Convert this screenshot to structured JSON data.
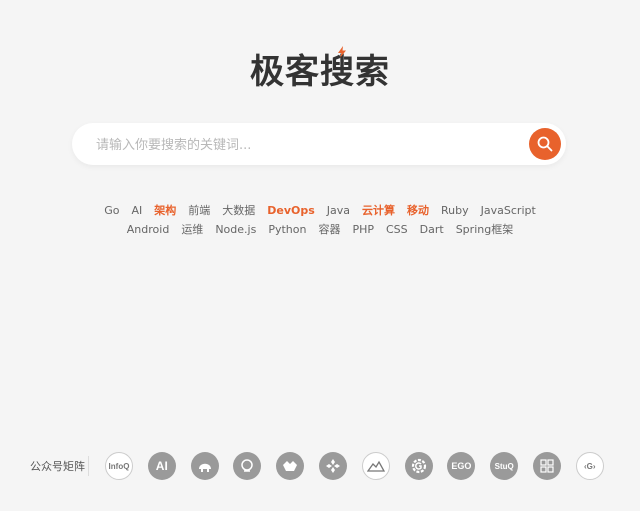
{
  "brand": {
    "logo_text": "极客搜索"
  },
  "search": {
    "placeholder": "请输入你要搜索的关键词..."
  },
  "tags": [
    {
      "label": "Go",
      "hot": false
    },
    {
      "label": "AI",
      "hot": false
    },
    {
      "label": "架构",
      "hot": true
    },
    {
      "label": "前端",
      "hot": false
    },
    {
      "label": "大数据",
      "hot": false
    },
    {
      "label": "DevOps",
      "hot": true
    },
    {
      "label": "Java",
      "hot": false
    },
    {
      "label": "云计算",
      "hot": true
    },
    {
      "label": "移动",
      "hot": true
    },
    {
      "label": "Ruby",
      "hot": false
    },
    {
      "label": "JavaScript",
      "hot": false
    },
    {
      "label": "Android",
      "hot": false
    },
    {
      "label": "运维",
      "hot": false
    },
    {
      "label": "Node.js",
      "hot": false
    },
    {
      "label": "Python",
      "hot": false
    },
    {
      "label": "容器",
      "hot": false
    },
    {
      "label": "PHP",
      "hot": false
    },
    {
      "label": "CSS",
      "hot": false
    },
    {
      "label": "Dart",
      "hot": false
    },
    {
      "label": "Spring框架",
      "hot": false
    }
  ],
  "matrix": {
    "label": "公众号矩阵",
    "accounts": [
      {
        "icon": "infoq-logo-icon",
        "text": "InfoQ",
        "style": "light"
      },
      {
        "icon": "ai-logo-icon",
        "text": "AI",
        "style": "dark"
      },
      {
        "icon": "elephant-logo-icon",
        "text": "",
        "style": "dark"
      },
      {
        "icon": "head-logo-icon",
        "text": "",
        "style": "dark"
      },
      {
        "icon": "animal-logo-icon",
        "text": "",
        "style": "dark"
      },
      {
        "icon": "diamond-grid-logo-icon",
        "text": "",
        "style": "dark"
      },
      {
        "icon": "mountain-logo-icon",
        "text": "",
        "style": "light"
      },
      {
        "icon": "gear-g-logo-icon",
        "text": "",
        "style": "dark"
      },
      {
        "icon": "ego-logo-icon",
        "text": "EGO",
        "style": "dark"
      },
      {
        "icon": "stuq-logo-icon",
        "text": "StuQ",
        "style": "dark"
      },
      {
        "icon": "geek-time-logo-icon",
        "text": "",
        "style": "dark"
      },
      {
        "icon": "g-bracket-logo-icon",
        "text": "‹G›",
        "style": "light"
      }
    ]
  },
  "colors": {
    "accent": "#e8622c",
    "background": "#f5f5f5",
    "tag_text": "#666666"
  }
}
